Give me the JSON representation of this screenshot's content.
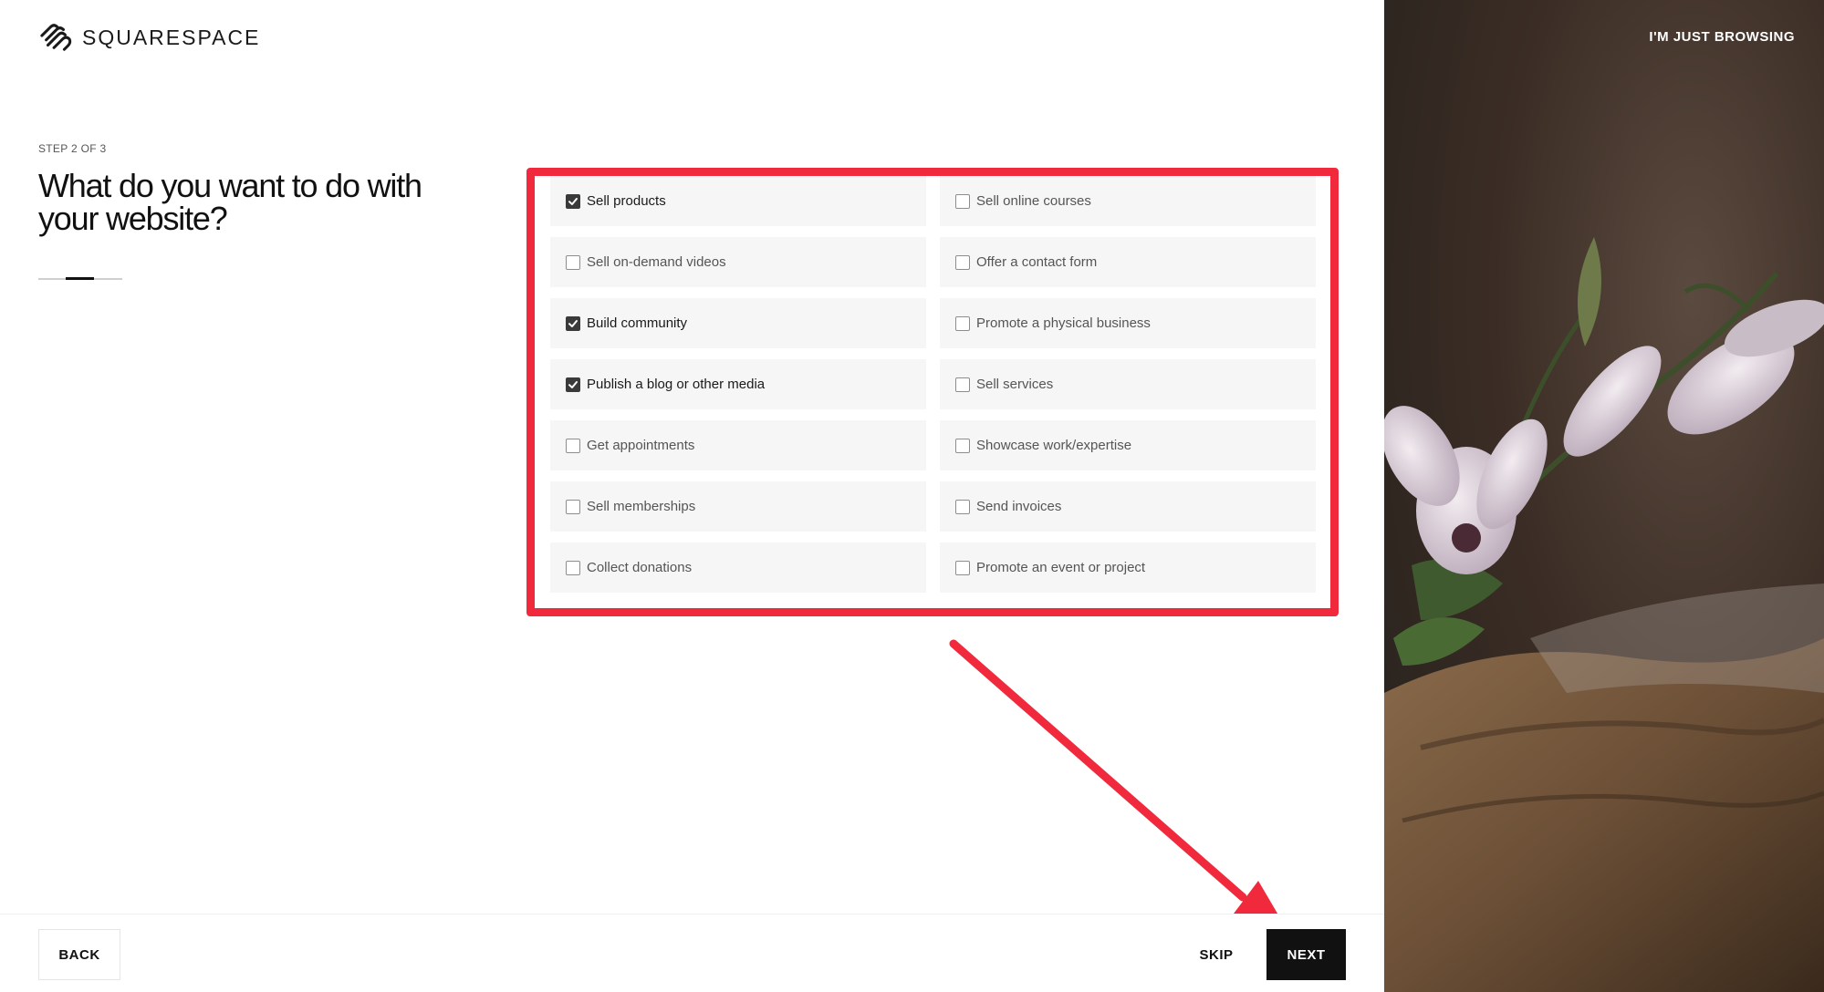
{
  "brand": {
    "name": "SQUARESPACE"
  },
  "header": {
    "browse_label": "I'M JUST BROWSING"
  },
  "step": {
    "label": "STEP 2 OF 3",
    "current": 2,
    "total": 3
  },
  "question": {
    "title": "What do you want to do with your website?"
  },
  "options": [
    {
      "label": "Sell products",
      "checked": true
    },
    {
      "label": "Sell online courses",
      "checked": false
    },
    {
      "label": "Sell on-demand videos",
      "checked": false
    },
    {
      "label": "Offer a contact form",
      "checked": false
    },
    {
      "label": "Build community",
      "checked": true
    },
    {
      "label": "Promote a physical business",
      "checked": false
    },
    {
      "label": "Publish a blog or other media",
      "checked": true
    },
    {
      "label": "Sell services",
      "checked": false
    },
    {
      "label": "Get appointments",
      "checked": false
    },
    {
      "label": "Showcase work/expertise",
      "checked": false
    },
    {
      "label": "Sell memberships",
      "checked": false
    },
    {
      "label": "Send invoices",
      "checked": false
    },
    {
      "label": "Collect donations",
      "checked": false
    },
    {
      "label": "Promote an event or project",
      "checked": false
    }
  ],
  "footer": {
    "back_label": "BACK",
    "skip_label": "SKIP",
    "next_label": "NEXT"
  },
  "colors": {
    "annotation": "#f1293d",
    "primary_button": "#111111",
    "option_bg": "#f6f6f6"
  },
  "icons": {
    "logo": "squarespace-logo-icon",
    "checkbox": "checkmark-icon",
    "annotation": "red-arrow-icon"
  }
}
